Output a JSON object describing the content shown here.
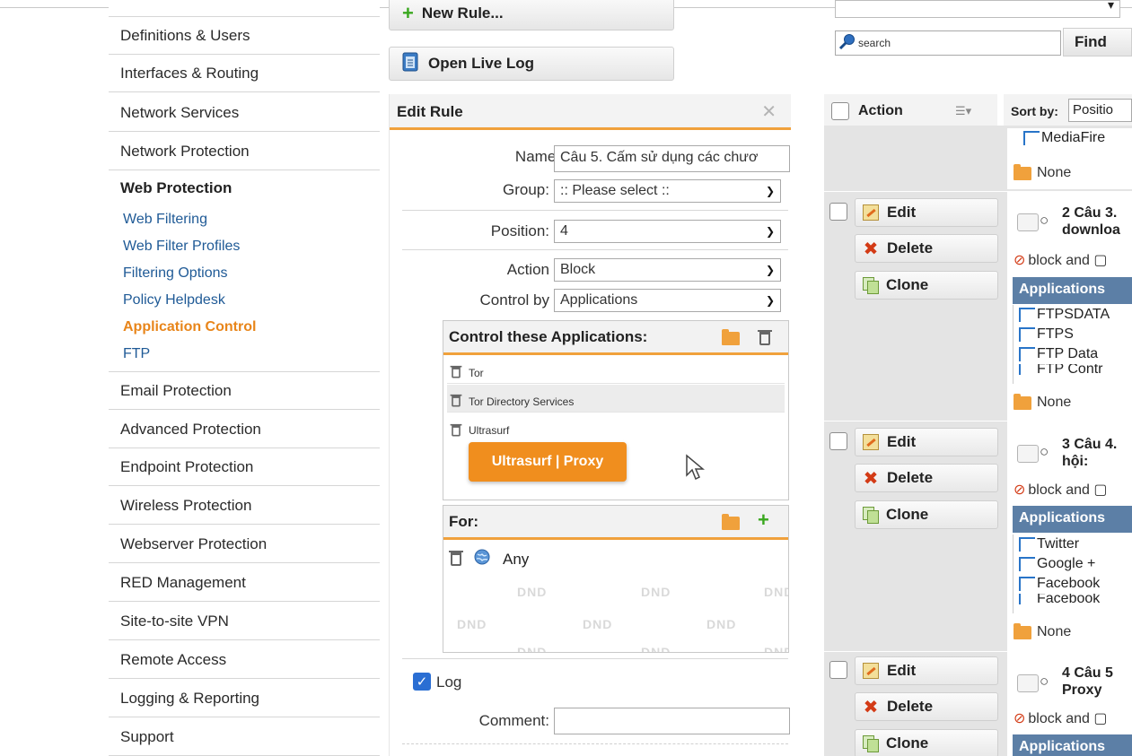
{
  "sidebar": {
    "items_top": [
      {
        "label": "Definitions & Users"
      },
      {
        "label": "Interfaces & Routing"
      },
      {
        "label": "Network Services"
      },
      {
        "label": "Network Protection"
      }
    ],
    "active_group": {
      "title": "Web Protection",
      "subitems": [
        {
          "label": "Web Filtering"
        },
        {
          "label": "Web Filter Profiles"
        },
        {
          "label": "Filtering Options"
        },
        {
          "label": "Policy Helpdesk"
        },
        {
          "label": "Application Control"
        },
        {
          "label": "FTP"
        }
      ]
    },
    "items_bottom": [
      {
        "label": "Email Protection"
      },
      {
        "label": "Advanced Protection"
      },
      {
        "label": "Endpoint Protection"
      },
      {
        "label": "Wireless Protection"
      },
      {
        "label": "Webserver Protection"
      },
      {
        "label": "RED Management"
      },
      {
        "label": "Site-to-site VPN"
      },
      {
        "label": "Remote Access"
      },
      {
        "label": "Logging & Reporting"
      },
      {
        "label": "Support"
      }
    ]
  },
  "toolbar": {
    "new_rule_label": "New Rule...",
    "open_live_log_label": "Open Live Log"
  },
  "search": {
    "placeholder": "search",
    "find_label": "Find"
  },
  "edit_rule": {
    "title": "Edit Rule",
    "name_label": "Name:",
    "name_value": "Câu 5. Cấm sử dụng các chươ",
    "group_label": "Group:",
    "group_value": ":: Please select ::",
    "position_label": "Position:",
    "position_value": "4",
    "action_label": "Action",
    "action_value": "Block",
    "control_by_label": "Control by",
    "control_by_value": "Applications",
    "control_apps_title": "Control these Applications:",
    "apps": [
      {
        "label": "Tor"
      },
      {
        "label": "Tor Directory Services"
      },
      {
        "label": "Ultrasurf"
      }
    ],
    "drag_chip": "Ultrasurf | Proxy",
    "for_title": "For:",
    "for_any": "Any",
    "dnd_text": "DND",
    "log_label": "Log",
    "log_checked": true,
    "comment_label": "Comment:"
  },
  "rules_list": {
    "header": {
      "action_label": "Action",
      "sort_label": "Sort by:",
      "sort_value": "Positio"
    },
    "rule0": {
      "apps": [
        "MediaFire"
      ],
      "none_label": "None"
    },
    "buttons": {
      "edit": "Edit",
      "delete": "Delete",
      "clone": "Clone"
    },
    "rules": [
      {
        "num_title": "2 Câu 3.",
        "title_line2": "downloa",
        "action_text": "block and",
        "apps_header": "Applications",
        "apps": [
          "FTPSDATA",
          "FTPS",
          "FTP Data",
          "FTP Contr"
        ],
        "none_label": "None"
      },
      {
        "num_title": "3 Câu 4.",
        "title_line2": "hội:",
        "action_text": "block and",
        "apps_header": "Applications",
        "apps": [
          "Twitter",
          "Google +",
          "Facebook",
          "Facebook"
        ],
        "none_label": "None"
      },
      {
        "num_title": "4 Câu 5",
        "title_line2": "Proxy",
        "action_text": "block and",
        "apps_header": "Applications"
      }
    ]
  },
  "colors": {
    "accent_orange": "#f0a13c",
    "link_blue": "#1f5a96",
    "apps_header_blue": "#5c7fa6"
  }
}
